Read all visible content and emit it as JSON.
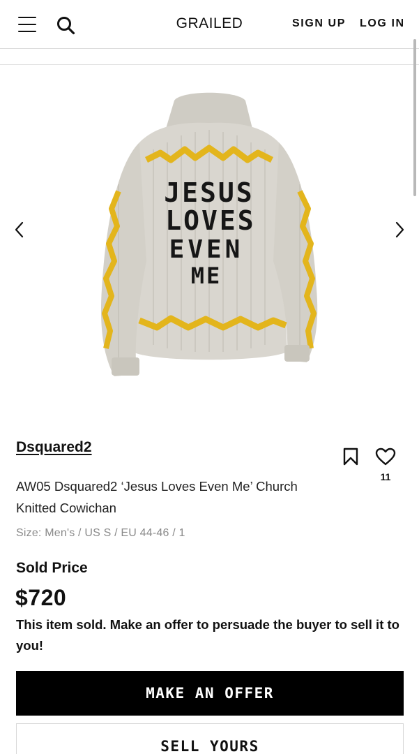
{
  "header": {
    "logo": "GRAILED",
    "sign_up": "SIGN UP",
    "log_in": "LOG IN",
    "menu_icon": "hamburger-menu-icon",
    "search_icon": "search-icon"
  },
  "gallery": {
    "prev_icon": "chevron-left-icon",
    "next_icon": "chevron-right-icon",
    "image_text": [
      "JESUS",
      "LOVES",
      "EVEN",
      "ME"
    ]
  },
  "listing": {
    "brand": "Dsquared2",
    "title": "AW05 Dsquared2 ‘Jesus Loves Even Me’ Church Knitted Cowichan",
    "size": "Size: Men's / US S / EU 44-46 / 1",
    "like_count": "11",
    "sold_label": "Sold Price",
    "price": "$720",
    "sold_message": "This item sold. Make an offer to persuade the buyer to sell it to you!"
  },
  "actions": {
    "make_offer": "MAKE AN OFFER",
    "sell_yours": "SELL YOURS"
  },
  "colors": {
    "sweater": "#d9d6cf",
    "accent_yellow": "#e3b51c",
    "text": "#111111",
    "button_dark": "#000000"
  }
}
